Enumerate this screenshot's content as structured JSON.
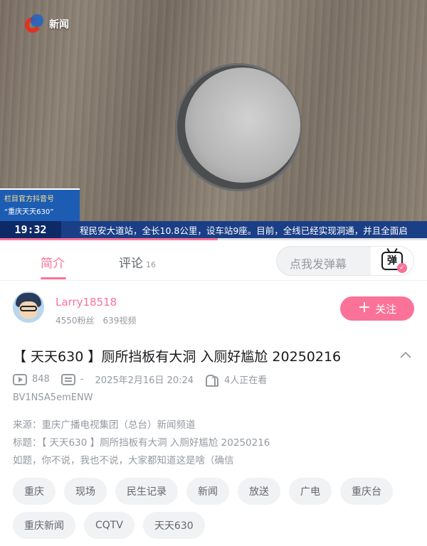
{
  "video": {
    "station_logo_text": "新闻",
    "program_badge_line1": "栏目官方抖音号",
    "program_badge_line2": "“重庆天天630”",
    "ticker_time": "19:32",
    "ticker_text": "程民安大道站，全长10.8公里，设车站9座。目前，全线已经实现洞通，并且全面启",
    "progress_fraction": 0.51
  },
  "tabs": [
    {
      "label": "简介",
      "active": true
    },
    {
      "label": "评论",
      "count": "16",
      "active": false
    }
  ],
  "danmaku": {
    "placeholder": "点我发弹幕",
    "button_glyph": "弹"
  },
  "uploader": {
    "name": "Larry18518",
    "fans": "4550粉丝",
    "videos": "639视频",
    "follow_label": "关注"
  },
  "video_info": {
    "title": "【 天天630 】厕所挡板有大洞 入厕好尴尬 20250216",
    "views": "848",
    "danmaku_count": "-",
    "date": "2025年2月16日 20:24",
    "viewers": "4人正在看",
    "bvid": "BV1NSA5emENW"
  },
  "description": {
    "lines": [
      "来源：重庆广播电视集团（总台）新闻频道",
      "标题：【 天天630 】厕所挡板有大洞 入厕好尴尬 20250216",
      "如题，你不说，我也不说，大家都知道这是啥（确信"
    ]
  },
  "tags": [
    "重庆",
    "现场",
    "民生记录",
    "新闻",
    "放送",
    "广电",
    "重庆台",
    "重庆新闻",
    "CQTV",
    "天天630"
  ],
  "colors": {
    "accent": "#fb7299",
    "ticker_bg": "#1b3f86"
  }
}
